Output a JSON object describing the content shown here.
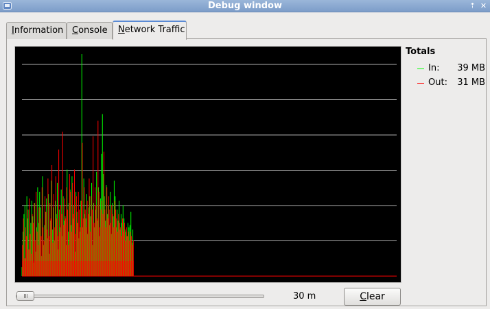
{
  "window": {
    "title": "Debug window"
  },
  "tabs": [
    {
      "label": "Information",
      "mnemonic": "I",
      "rest": "nformation",
      "active": false
    },
    {
      "label": "Console",
      "mnemonic": "C",
      "rest": "onsole",
      "active": false
    },
    {
      "label": "Network Traffic",
      "mnemonic": "N",
      "rest": "etwork Traffic",
      "active": true
    }
  ],
  "totals": {
    "heading": "Totals",
    "in": {
      "label": "In:",
      "value": "39 MB",
      "color": "#00ff00"
    },
    "out": {
      "label": "Out:",
      "value": "31 MB",
      "color": "#ff0000"
    }
  },
  "controls": {
    "range_label": "30 m",
    "slider_position": 0.0,
    "clear_label": "Clear",
    "clear_mnemonic": "C",
    "clear_rest": "lear"
  },
  "chart_data": {
    "type": "bar",
    "title": "",
    "xlabel": "",
    "ylabel": "",
    "grid": true,
    "grid_lines": 6,
    "ylim": [
      0,
      100
    ],
    "series": [
      {
        "label": "In",
        "color": "#00ff00",
        "values": [
          4,
          20,
          28,
          32,
          8,
          36,
          26,
          30,
          12,
          24,
          34,
          27,
          6,
          33,
          11,
          22,
          40,
          24,
          38,
          31,
          9,
          45,
          14,
          23,
          29,
          35,
          17,
          37,
          10,
          25,
          43,
          21,
          31,
          16,
          34,
          28,
          42,
          12,
          30,
          22,
          39,
          18,
          36,
          25,
          27,
          14,
          48,
          20,
          33,
          39,
          23,
          45,
          26,
          32,
          11,
          38,
          29,
          24,
          17,
          20,
          34,
          100,
          22,
          44,
          28,
          26,
          37,
          19,
          31,
          36,
          27,
          42,
          14,
          33,
          22,
          30,
          47,
          25,
          40,
          18,
          35,
          55,
          73,
          46,
          36,
          25,
          41,
          28,
          32,
          23,
          38,
          19,
          33,
          27,
          43,
          36,
          22,
          30,
          25,
          34,
          21,
          28,
          24,
          32,
          26,
          21,
          20,
          18,
          24,
          22,
          23,
          29,
          15,
          21
        ]
      },
      {
        "label": "Out",
        "color": "#ff0000",
        "values": [
          14,
          26,
          8,
          22,
          18,
          30,
          12,
          35,
          19,
          10,
          28,
          24,
          33,
          16,
          38,
          20,
          14,
          31,
          26,
          18,
          40,
          22,
          16,
          36,
          29,
          21,
          44,
          18,
          33,
          26,
          50,
          15,
          37,
          22,
          45,
          26,
          18,
          57,
          20,
          32,
          28,
          65,
          23,
          35,
          26,
          40,
          30,
          14,
          46,
          38,
          20,
          42,
          28,
          48,
          19,
          36,
          24,
          38,
          30,
          22,
          34,
          60,
          26,
          40,
          30,
          22,
          34,
          28,
          44,
          20,
          36,
          30,
          63,
          24,
          40,
          32,
          26,
          70,
          38,
          22,
          30,
          34,
          28,
          56,
          30,
          22,
          40,
          26,
          36,
          30,
          24,
          32,
          28,
          22,
          34,
          30,
          26,
          20,
          28,
          24,
          22,
          18,
          26,
          20,
          24,
          16,
          22,
          18,
          20,
          16,
          20,
          18,
          14,
          16
        ]
      }
    ]
  }
}
